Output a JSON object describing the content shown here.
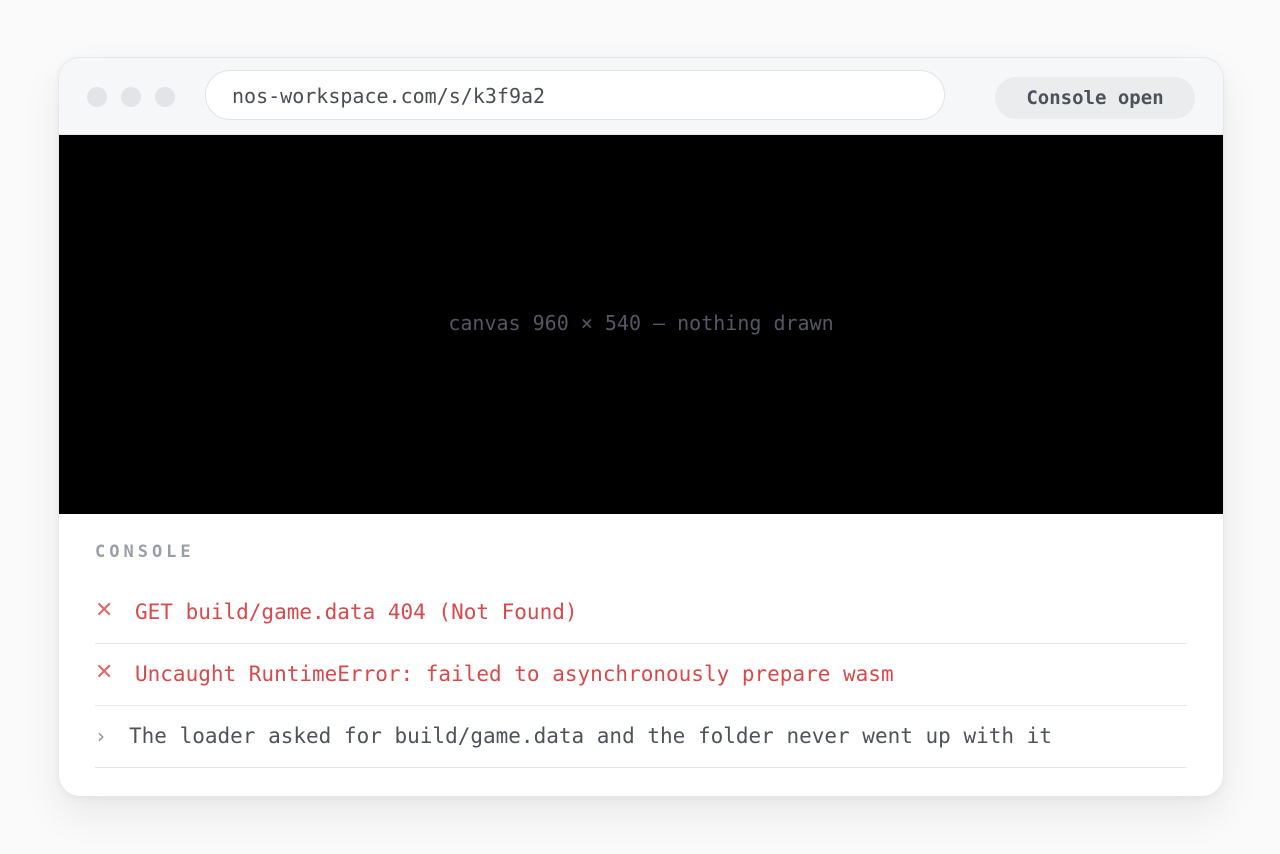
{
  "browser": {
    "url": "nos-workspace.com/s/k3f9a2",
    "status_pill": "Console open"
  },
  "canvas": {
    "caption": "canvas 960 × 540 — nothing drawn"
  },
  "console": {
    "heading": "CONSOLE",
    "entries": [
      {
        "level": "error",
        "icon": "x-icon",
        "text": "GET build/game.data 404 (Not Found)"
      },
      {
        "level": "error",
        "icon": "x-icon",
        "text": "Uncaught RuntimeError: failed to asynchronously prepare wasm"
      },
      {
        "level": "log",
        "icon": "chevron-right-icon",
        "text": "The loader asked for build/game.data and the folder never went up with it"
      }
    ]
  },
  "colors": {
    "error": "#d9494b",
    "canvas_bg": "#000000",
    "muted": "#9a9ea8"
  }
}
